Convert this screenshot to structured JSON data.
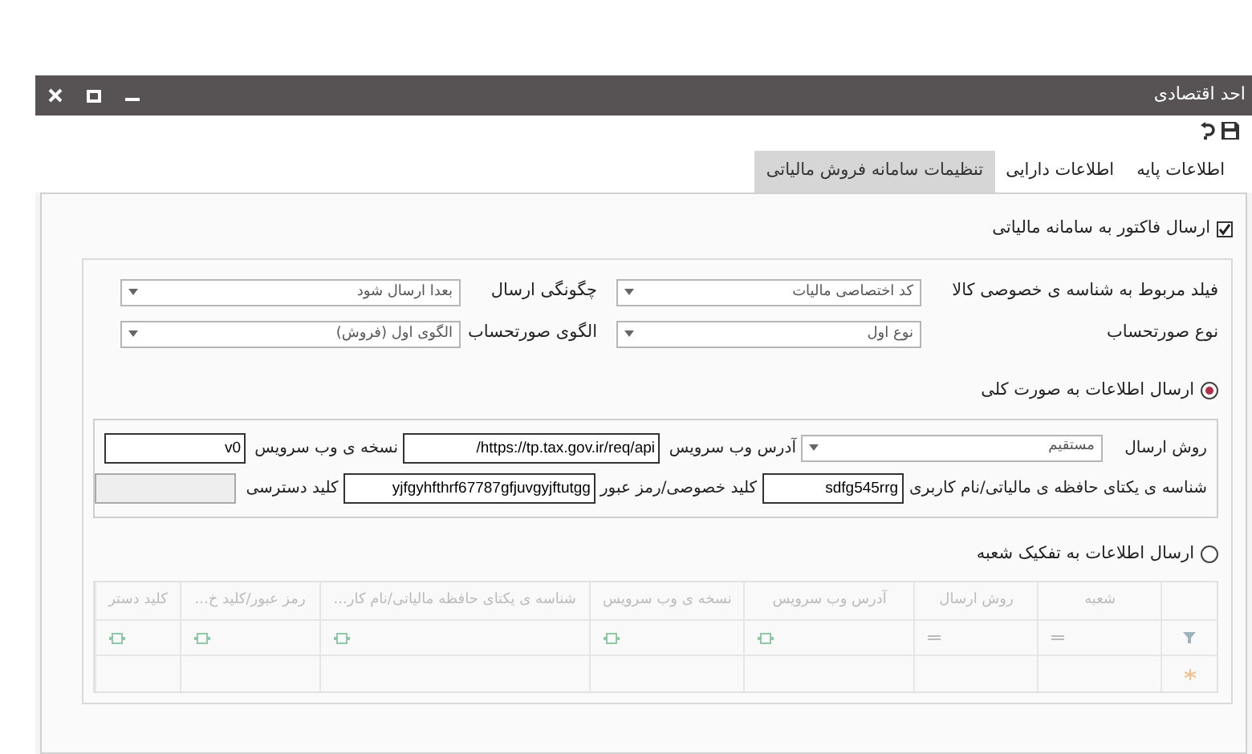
{
  "window": {
    "title": "احد اقتصادی"
  },
  "tabs": [
    {
      "label": "اطلاعات پایه",
      "selected": false
    },
    {
      "label": "اطلاعات دارایی",
      "selected": false
    },
    {
      "label": "تنظیمات سامانه فروش مالیاتی",
      "selected": true
    }
  ],
  "send_invoice": {
    "label": "ارسال فاکتور به سامانه مالیاتی",
    "checked": true
  },
  "settings_rows": [
    [
      {
        "label": "فیلد مربوط به شناسه ی خصوصی کالا",
        "value": "کد اختصاصی مالیات"
      },
      {
        "label": "چگونگی ارسال",
        "value": "بعدا ارسال شود"
      }
    ],
    [
      {
        "label": "نوع صورتحساب",
        "value": "نوع اول"
      },
      {
        "label": "الگوی صورتحساب",
        "value": "الگوی اول (فروش)"
      }
    ]
  ],
  "send_modes": [
    {
      "label": "ارسال اطلاعات به صورت کلی",
      "selected": true
    },
    {
      "label": "ارسال اطلاعات به تفکیک شعبه",
      "selected": false
    }
  ],
  "general_group": {
    "rows": [
      [
        {
          "kind": "dropdown",
          "label": "روش ارسال",
          "value": "مستقیم",
          "disabled": false
        },
        {
          "kind": "text",
          "label": "آدرس وب سرویس",
          "value": "/https://tp.tax.gov.ir/req/api",
          "disabled": false
        },
        {
          "kind": "text",
          "label": "نسخه ی وب سرویس",
          "value": "v0",
          "disabled": false
        }
      ],
      [
        {
          "kind": "text",
          "label": "شناسه ی یکتای حافظه ی مالیاتی/نام کاربری",
          "value": "sdfg545rrg",
          "disabled": false
        },
        {
          "kind": "text",
          "label": "کلید خصوصی/رمز عبور",
          "value": "yjfgyhfthrf67787gfjuvgyjftutgg",
          "disabled": false
        },
        {
          "kind": "text",
          "label": "کلید دسترسی",
          "disabled": true
        }
      ]
    ]
  },
  "branch_table": {
    "columns": [
      {
        "title": "شعبه",
        "kind": "equals"
      },
      {
        "title": "روش ارسال",
        "kind": "equals"
      },
      {
        "title": "آدرس وب سرویس",
        "kind": "text"
      },
      {
        "title": "نسخه ی وب سرویس",
        "kind": "text"
      },
      {
        "title": "شناسه ی یکتای حافظه مالیاتی/نام کار...",
        "kind": "text"
      },
      {
        "title": "رمز عبور/کلید خ...",
        "kind": "text"
      },
      {
        "title": "کلید دستر",
        "kind": "text"
      }
    ]
  }
}
